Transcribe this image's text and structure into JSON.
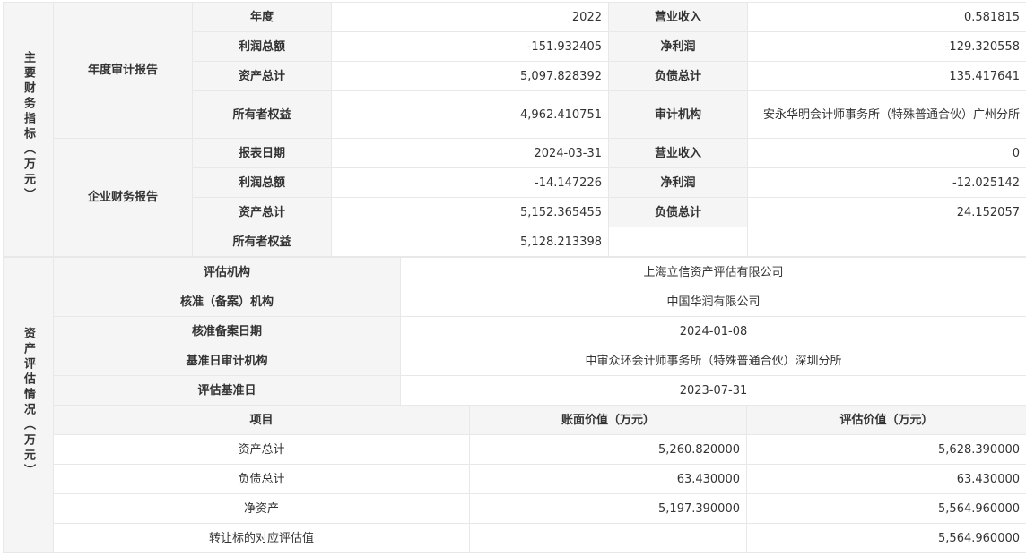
{
  "section1": {
    "side_label": "主要财务指标（万元）",
    "annual": {
      "group_label": "年度审计报告",
      "rows": [
        {
          "k1": "年度",
          "v1": "2022",
          "k2": "营业收入",
          "v2": "0.581815"
        },
        {
          "k1": "利润总额",
          "v1": "-151.932405",
          "k2": "净利润",
          "v2": "-129.320558"
        },
        {
          "k1": "资产总计",
          "v1": "5,097.828392",
          "k2": "负债总计",
          "v2": "135.417641"
        },
        {
          "k1": "所有者权益",
          "v1": "4,962.410751",
          "k2": "审计机构",
          "v2": "安永华明会计师事务所（特殊普通合伙）广州分所"
        }
      ]
    },
    "enterprise": {
      "group_label": "企业财务报告",
      "rows": [
        {
          "k1": "报表日期",
          "v1": "2024-03-31",
          "k2": "营业收入",
          "v2": "0"
        },
        {
          "k1": "利润总额",
          "v1": "-14.147226",
          "k2": "净利润",
          "v2": "-12.025142"
        },
        {
          "k1": "资产总计",
          "v1": "5,152.365455",
          "k2": "负债总计",
          "v2": "24.152057"
        },
        {
          "k1": "所有者权益",
          "v1": "5,128.213398",
          "k2": "",
          "v2": ""
        }
      ]
    }
  },
  "section2": {
    "side_label": "资产评估情况（万元）",
    "info_rows": [
      {
        "label": "评估机构",
        "value": "上海立信资产评估有限公司"
      },
      {
        "label": "核准（备案）机构",
        "value": "中国华润有限公司"
      },
      {
        "label": "核准备案日期",
        "value": "2024-01-08"
      },
      {
        "label": "基准日审计机构",
        "value": "中审众环会计师事务所（特殊普通合伙）深圳分所"
      },
      {
        "label": "评估基准日",
        "value": "2023-07-31"
      }
    ],
    "table_headers": [
      "项目",
      "账面价值（万元）",
      "评估价值（万元）"
    ],
    "table_rows": [
      {
        "item": "资产总计",
        "book": "5,260.820000",
        "appraised": "5,628.390000"
      },
      {
        "item": "负债总计",
        "book": "63.430000",
        "appraised": "63.430000"
      },
      {
        "item": "净资产",
        "book": "5,197.390000",
        "appraised": "5,564.960000"
      },
      {
        "item": "转让标的对应评估值",
        "book": "",
        "appraised": "5,564.960000"
      }
    ]
  }
}
